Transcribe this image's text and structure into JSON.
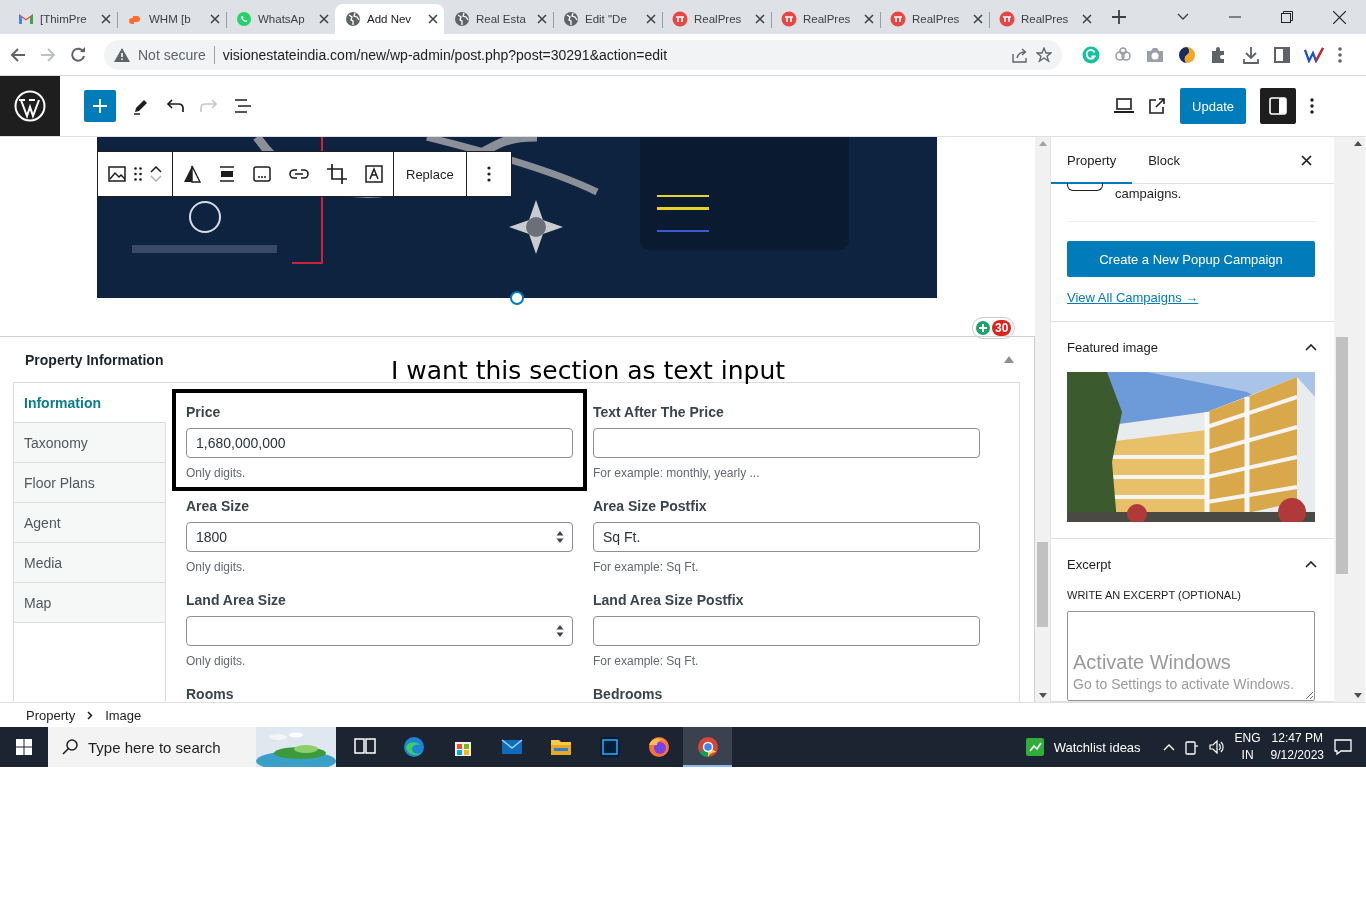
{
  "browser": {
    "tabs": [
      {
        "title": "[ThimPre",
        "kind": "gmail",
        "selected": false
      },
      {
        "title": "WHM [b",
        "kind": "cpanel",
        "selected": false
      },
      {
        "title": "WhatsAp",
        "kind": "whatsapp",
        "selected": false
      },
      {
        "title": "Add Nev",
        "kind": "globe",
        "selected": true
      },
      {
        "title": "Real Esta",
        "kind": "globe",
        "selected": false
      },
      {
        "title": "Edit \"De",
        "kind": "globe",
        "selected": false
      },
      {
        "title": "RealPres",
        "kind": "realpress",
        "selected": false
      },
      {
        "title": "RealPres",
        "kind": "realpress",
        "selected": false
      },
      {
        "title": "RealPres",
        "kind": "realpress",
        "selected": false
      },
      {
        "title": "RealPres",
        "kind": "realpress",
        "selected": false
      }
    ],
    "forward_disabled": true,
    "security": "Not secure",
    "url": "visionestateindia.com/new/wp-admin/post.php?post=30291&action=edit"
  },
  "editor_toolbar": {
    "redo_disabled": true,
    "update_button": "Update",
    "settings_pressed": true
  },
  "block_toolbar": {
    "move_down_disabled": true,
    "replace_button": "Replace"
  },
  "badge": {
    "count": "30"
  },
  "property_box": {
    "title": "Property Information",
    "annotation": "I want this section as text input",
    "tabs": [
      {
        "label": "Information",
        "selected": true
      },
      {
        "label": "Taxonomy",
        "selected": false
      },
      {
        "label": "Floor Plans",
        "selected": false
      },
      {
        "label": "Agent",
        "selected": false
      },
      {
        "label": "Media",
        "selected": false
      },
      {
        "label": "Map",
        "selected": false
      }
    ],
    "fields": [
      {
        "kind": "text",
        "label": "Price",
        "value": "1,680,000,000",
        "help": "Only digits.",
        "highlighted": true
      },
      {
        "kind": "text",
        "label": "Text After The Price",
        "help": "For example: monthly, yearly ..."
      },
      {
        "kind": "number",
        "label": "Area Size",
        "value": "1800",
        "help": "Only digits."
      },
      {
        "kind": "text",
        "label": "Area Size Postfix",
        "value": "Sq Ft.",
        "help": "For example: Sq Ft."
      },
      {
        "kind": "number",
        "label": "Land Area Size",
        "help": "Only digits."
      },
      {
        "kind": "text",
        "label": "Land Area Size Postfix",
        "help": "For example: Sq Ft."
      },
      {
        "kind": "partial",
        "label": "Rooms"
      },
      {
        "kind": "partial",
        "label": "Bedrooms"
      }
    ]
  },
  "sidebar": {
    "tabs": [
      {
        "label": "Property",
        "selected": true
      },
      {
        "label": "Block",
        "selected": false
      }
    ],
    "toggle": {
      "on": false,
      "text": "campaigns."
    },
    "create_button": "Create a New Popup Campaign",
    "view_link": "View All Campaigns →",
    "panels": [
      {
        "title": "Featured image",
        "expanded": true
      },
      {
        "title": "Excerpt",
        "expanded": true
      }
    ],
    "excerpt_label": "WRITE AN EXCERPT (OPTIONAL)"
  },
  "windows_notice": {
    "title": "Activate Windows",
    "text": "Go to Settings to activate Windows."
  },
  "breadcrumb": [
    "Property",
    "Image"
  ],
  "taskbar": {
    "search_placeholder": "Type here to search",
    "apps": [
      {
        "kind": "taskview",
        "selected": false
      },
      {
        "kind": "edge",
        "selected": false
      },
      {
        "kind": "store",
        "selected": false
      },
      {
        "kind": "mail",
        "selected": false
      },
      {
        "kind": "explorer",
        "selected": false
      },
      {
        "kind": "photoshop",
        "selected": false
      },
      {
        "kind": "firefox",
        "selected": false
      },
      {
        "kind": "chrome",
        "selected": true
      }
    ],
    "widget": "Watchlist ideas",
    "language": "ENG",
    "region": "IN",
    "time": "12:47 PM",
    "date": "9/12/2023"
  }
}
